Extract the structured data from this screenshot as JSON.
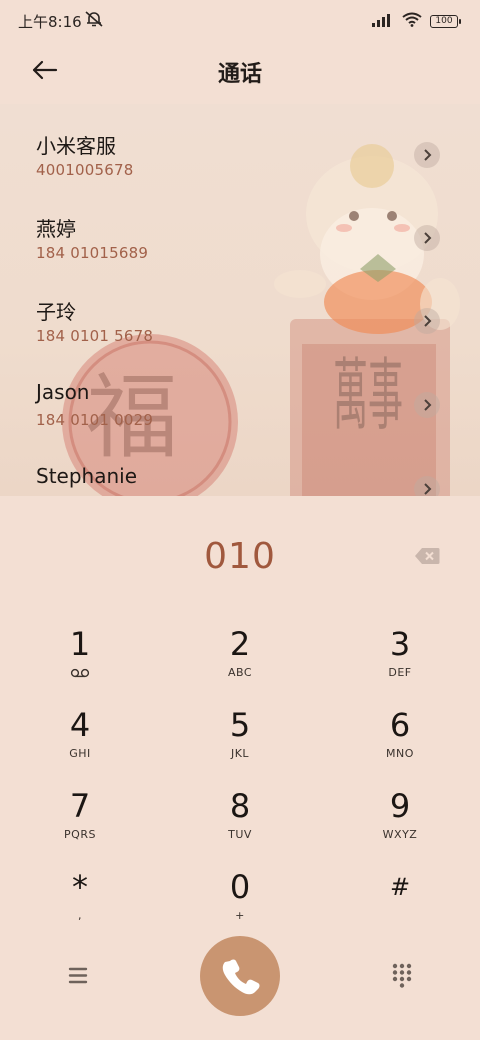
{
  "status_bar": {
    "time": "上午8:16",
    "battery": "100"
  },
  "header": {
    "title": "通话"
  },
  "contacts": [
    {
      "name": "小米客服",
      "number": "4001005678"
    },
    {
      "name": "燕婷",
      "number": "184 01015689"
    },
    {
      "name": "子玲",
      "number": "184 0101 5678"
    },
    {
      "name": "Jason",
      "number": "184 0101 0029"
    },
    {
      "name": "Stephanie",
      "number": ""
    }
  ],
  "decor": {
    "seal_char": "福",
    "banner_chars": "萬事"
  },
  "dialer": {
    "input": "010"
  },
  "keypad": [
    {
      "digit": "1",
      "letters": ""
    },
    {
      "digit": "2",
      "letters": "ABC"
    },
    {
      "digit": "3",
      "letters": "DEF"
    },
    {
      "digit": "4",
      "letters": "GHI"
    },
    {
      "digit": "5",
      "letters": "JKL"
    },
    {
      "digit": "6",
      "letters": "MNO"
    },
    {
      "digit": "7",
      "letters": "PQRS"
    },
    {
      "digit": "8",
      "letters": "TUV"
    },
    {
      "digit": "9",
      "letters": "WXYZ"
    },
    {
      "digit": "*",
      "letters": ","
    },
    {
      "digit": "0",
      "letters": "+"
    },
    {
      "digit": "#",
      "letters": ""
    }
  ],
  "colors": {
    "background": "#f3dfd3",
    "accent": "#a0583d",
    "call_button": "#c99571"
  },
  "icons": {
    "back": "arrow-left-icon",
    "backspace": "backspace-icon",
    "voicemail": "voicemail-icon",
    "menu": "menu-icon",
    "call": "phone-icon",
    "dialpad": "dialpad-icon",
    "mute": "bell-off-icon",
    "signal": "signal-icon",
    "wifi": "wifi-icon"
  }
}
